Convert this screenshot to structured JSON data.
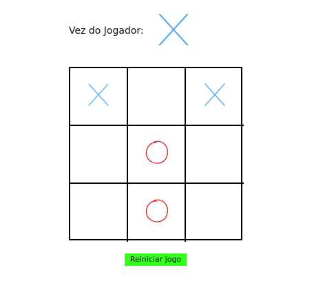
{
  "header": {
    "turn_label": "Vez do Jogador:",
    "current_player": "X"
  },
  "board": {
    "cells": [
      "X",
      "",
      "X",
      "",
      "O",
      "",
      "",
      "O",
      ""
    ]
  },
  "colors": {
    "x_mark": "#5aaef0",
    "o_mark": "#d62b2b",
    "grid_lines": "#000000",
    "reset_button": "#33ff1a"
  },
  "controls": {
    "reset_label": "Reiniciar jogo"
  }
}
